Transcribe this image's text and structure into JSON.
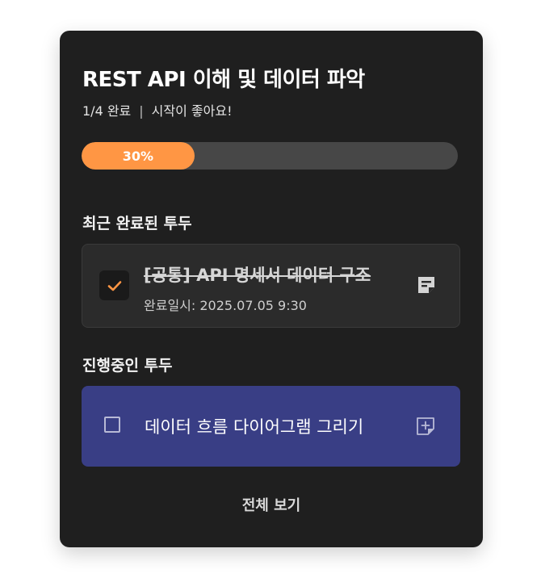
{
  "header": {
    "title": "REST API 이해 및 데이터 파악",
    "progress_count": "1/4 완료",
    "separator": "|",
    "encouragement": "시작이 좋아요!"
  },
  "progress": {
    "percent": 30,
    "label": "30%"
  },
  "recent_done": {
    "section_title": "최근 완료된 투두",
    "item": {
      "title": "[공통] API 명세서 데이터 구조",
      "completed_at": "완료일시: 2025.07.05 9:30",
      "checked": true
    }
  },
  "in_progress": {
    "section_title": "진행중인 투두",
    "item": {
      "title": "데이터 흐름 다이어그램 그리기",
      "checked": false
    }
  },
  "footer": {
    "view_all_label": "전체 보기"
  },
  "colors": {
    "card_bg": "#1f1f1f",
    "accent": "#ff9644",
    "track": "#474747",
    "in_progress_bg": "#393e85"
  },
  "icons": {
    "done_check": "check-icon",
    "done_memo": "note-icon",
    "progress_memo": "note-add-icon"
  }
}
